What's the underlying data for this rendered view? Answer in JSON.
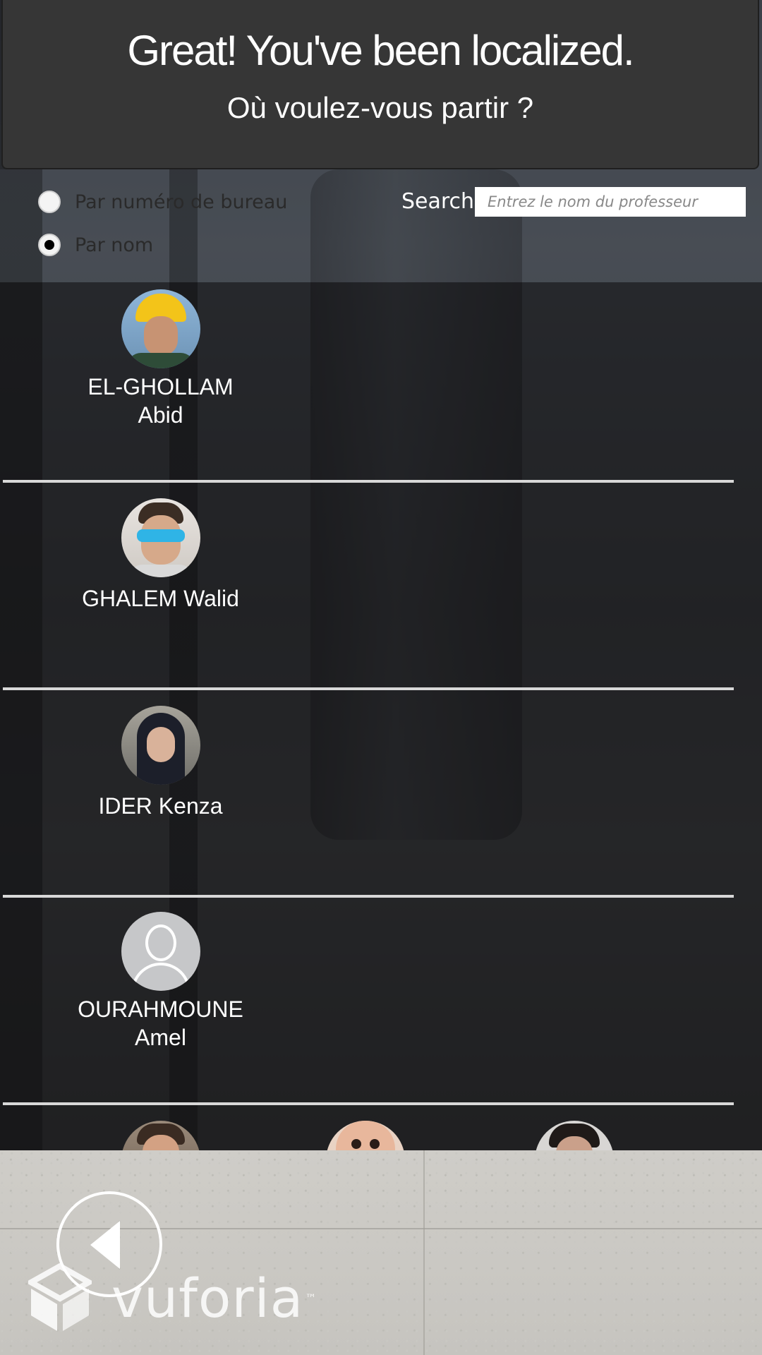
{
  "header": {
    "title": "Great! You've been localized.",
    "subtitle": "Où voulez-vous partir ?"
  },
  "search_options": {
    "radio_office": {
      "label": "Par numéro de bureau",
      "checked": false
    },
    "radio_name": {
      "label": "Par nom",
      "checked": true
    },
    "search_label": "Search",
    "search_placeholder": "Entrez le nom du professeur",
    "search_value": ""
  },
  "professors": [
    {
      "name_line1": "EL-GHOLLAM",
      "name_line2": "Abid",
      "avatar": "photo-avatar-helmet"
    },
    {
      "name_line1": "GHALEM Walid",
      "name_line2": "",
      "avatar": "photo-avatar-sunglasses"
    },
    {
      "name_line1": "IDER Kenza",
      "name_line2": "",
      "avatar": "photo-avatar-hijab"
    },
    {
      "name_line1": "OURAHMOUNE",
      "name_line2": "Amel",
      "avatar": "default-user-avatar"
    }
  ],
  "partial_row_avatars": [
    "photo-avatar",
    "photo-avatar",
    "photo-avatar"
  ],
  "footer": {
    "back_button_icon": "back-arrow-icon",
    "watermark_text": "vuforia",
    "watermark_tm": "™"
  },
  "colors": {
    "header_bg": "#363636",
    "list_overlay": "rgba(18,18,20,0.62)",
    "divider": "#d8d8d8",
    "text_light": "#ffffff"
  }
}
